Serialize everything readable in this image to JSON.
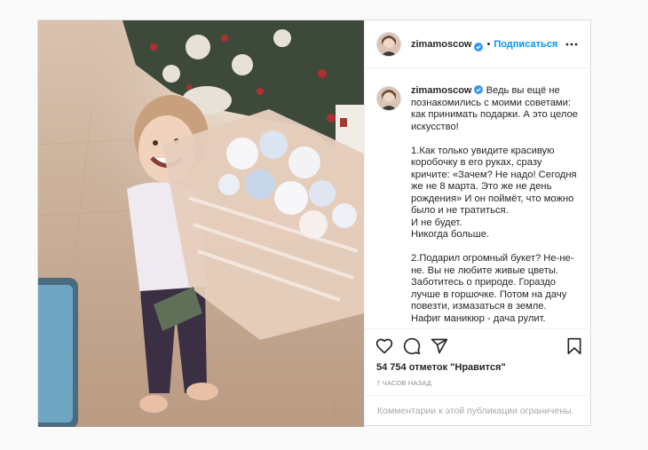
{
  "post": {
    "username": "zimamoscow",
    "follow_label": "Подписаться",
    "separator": "•",
    "caption_text": " Ведь вы ещё не познакомились с моими советами: как принимать подарки. А это целое искусство!\n\n1.Как только увидите красивую коробочку в его руках, сразу кричите: «Зачем? Не надо! Сегодня же не 8 марта. Это же не день рождения» И он поймёт, что можно было и не тратиться.\nИ не будет.\nНикогда больше.\n\n2.Подарил огромный букет? Не-не-не. Вы не любите живые цветы. Заботитесь о природе. Гораздо лучше в горшочке. Потом на дачу повезти, измазаться в земле. Нафиг маникюр - дача рулит.",
    "likes_text": "54 754 отметок \"Нравится\"",
    "timestamp": "7 ЧАСОВ НАЗАД",
    "comments_disabled": "Комментарии к этой публикации ограничены."
  },
  "icons": {
    "verified": "verified-badge-icon",
    "more": "more-options-icon",
    "like": "heart-icon",
    "comment": "comment-icon",
    "share": "share-icon",
    "save": "bookmark-icon"
  },
  "colors": {
    "accent": "#0095f6",
    "text": "#262626",
    "muted": "#8e8e8e",
    "border": "#dbdbdb"
  }
}
